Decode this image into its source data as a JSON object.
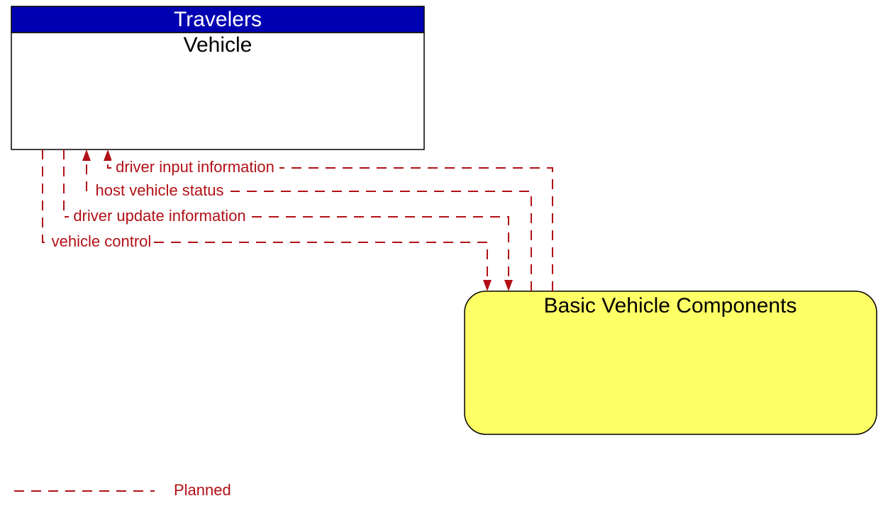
{
  "nodes": {
    "travelers": {
      "header": "Travelers",
      "title": "Vehicle"
    },
    "component": {
      "title": "Basic Vehicle Components"
    }
  },
  "flows": {
    "f1": "driver input information",
    "f2": "host vehicle status",
    "f3": "driver update information",
    "f4": "vehicle control"
  },
  "legend": {
    "planned": "Planned"
  }
}
